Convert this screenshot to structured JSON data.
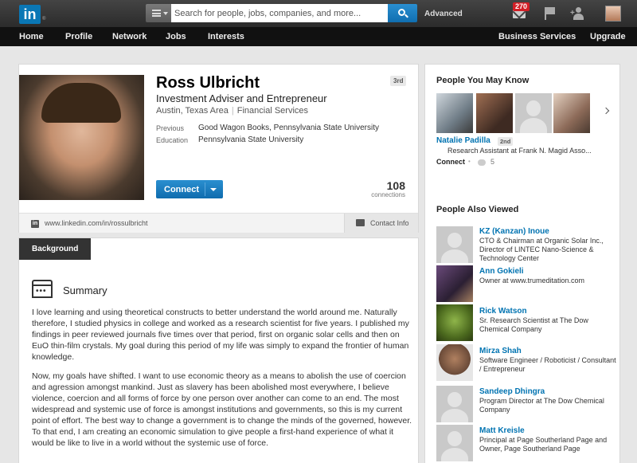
{
  "topbar": {
    "logo_text": "in",
    "logo_tm": "®",
    "search_placeholder": "Search for people, jobs, companies, and more...",
    "advanced_label": "Advanced",
    "inbox_badge": "270"
  },
  "nav": {
    "items": [
      "Home",
      "Profile",
      "Network",
      "Jobs",
      "Interests"
    ],
    "right_items": [
      "Business Services",
      "Upgrade"
    ]
  },
  "profile": {
    "name": "Ross Ulbricht",
    "degree": "3rd",
    "headline": "Investment Adviser and Entrepreneur",
    "location": "Austin, Texas Area",
    "industry": "Financial Services",
    "previous_label": "Previous",
    "previous_value": "Good Wagon Books, Pennsylvania State University",
    "education_label": "Education",
    "education_value": "Pennsylvania State University",
    "connect_label": "Connect",
    "connections_count": "108",
    "connections_label": "connections",
    "url": "www.linkedin.com/in/rossulbricht",
    "contact_label": "Contact Info"
  },
  "background": {
    "tab_label": "Background",
    "summary_title": "Summary",
    "paragraph1": "I love learning and using theoretical constructs to better understand the world around me. Naturally therefore, I studied physics in college and worked as a research scientist for five years. I published my findings in peer reviewed journals five times over that period, first on organic solar cells and then on EuO thin-film crystals. My goal during this period of my life was simply to expand the frontier of human knowledge.",
    "paragraph2": "Now, my goals have shifted. I want to use economic theory as a means to abolish the use of coercion and agression amongst mankind. Just as slavery has been abolished most everywhere, I believe violence, coercion and all forms of force by one person over another can come to an end. The most widespread and systemic use of force is amongst institutions and governments, so this is my current point of effort. The best way to change a government is to change the minds of the governed, however. To that end, I am creating an economic simulation to give people a first-hand experience of what it would be like to live in a world without the systemic use of force."
  },
  "pymk": {
    "heading": "People You May Know",
    "name": "Natalie Padilla",
    "degree": "2nd",
    "title": "Research Assistant at Frank N. Magid Asso...",
    "connect_label": "Connect",
    "dot": "•",
    "shared_count": "5"
  },
  "people_also_viewed": {
    "heading": "People Also Viewed",
    "people": [
      {
        "name": "KZ (Kanzan) Inoue",
        "desc": "CTO & Chairman at Organic Solar Inc., Director of LINTEC Nano-Science & Technology Center"
      },
      {
        "name": "Ann Gokieli",
        "desc": "Owner at www.trumeditation.com"
      },
      {
        "name": "Rick Watson",
        "desc": "Sr. Research Scientist at The Dow Chemical Company"
      },
      {
        "name": "Mirza Shah",
        "desc": "Software Engineer / Roboticist / Consultant / Entrepreneur"
      },
      {
        "name": "Sandeep Dhingra",
        "desc": "Program Director at The Dow Chemical Company"
      },
      {
        "name": "Matt Kreisle",
        "desc": "Principal at Page Southerland Page and Owner, Page Southerland Page"
      }
    ]
  },
  "colors": {
    "brand_blue": "#0a77b5",
    "link_blue": "#0073b1",
    "topbar": "#333333",
    "nav": "#111111",
    "badge_red": "#d31f26"
  }
}
